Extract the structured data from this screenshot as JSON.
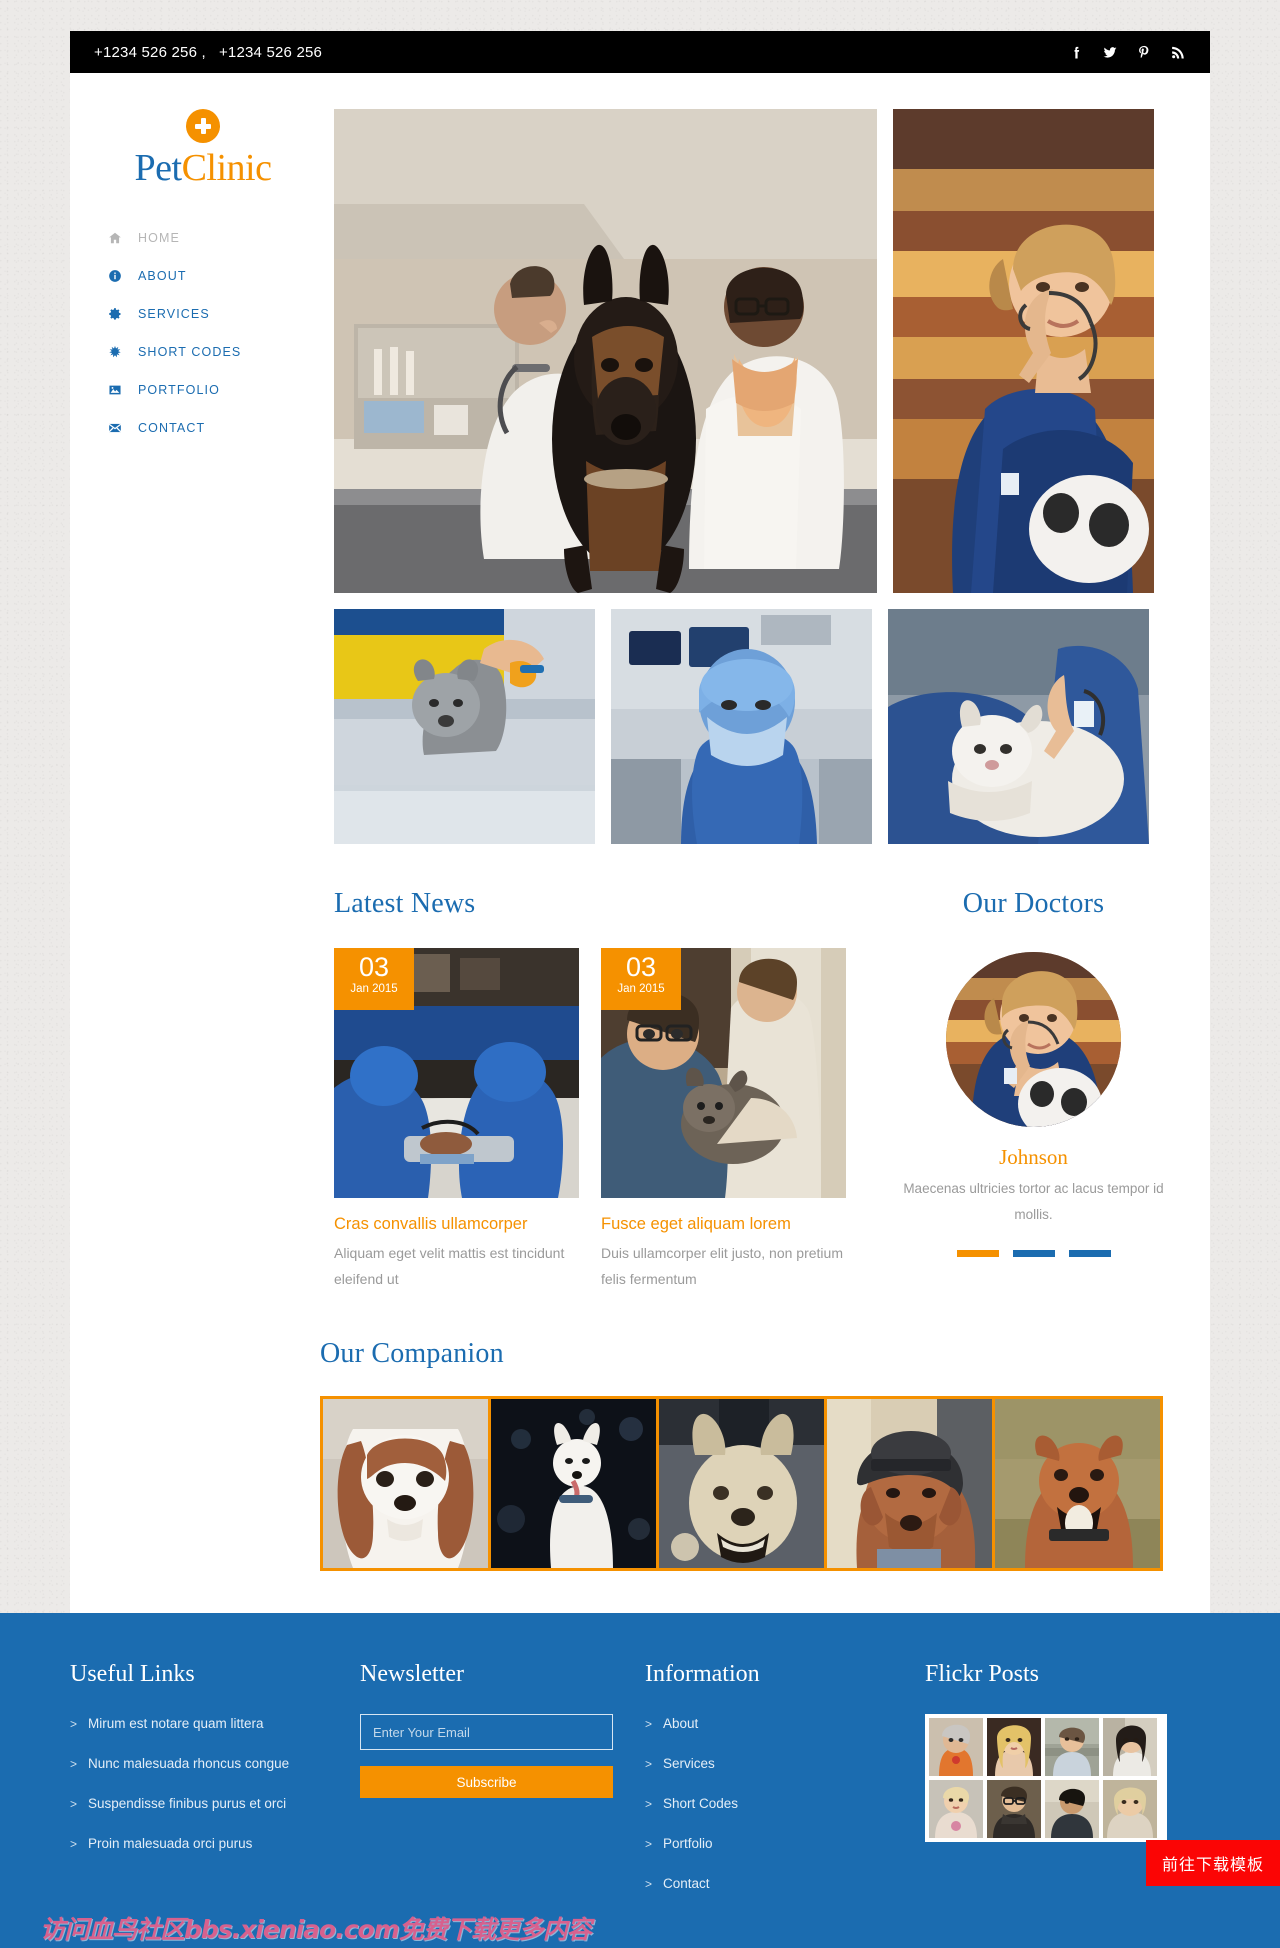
{
  "topbar": {
    "phones": "+1234 526 256 ,   +1234 526 256",
    "social": [
      {
        "name": "facebook-icon",
        "label": "Facebook"
      },
      {
        "name": "twitter-icon",
        "label": "Twitter"
      },
      {
        "name": "pinterest-icon",
        "label": "Pinterest"
      },
      {
        "name": "rss-icon",
        "label": "RSS"
      }
    ]
  },
  "brand": {
    "part1": "Pet",
    "part2": "Clinic",
    "mark": "plus-circle-icon"
  },
  "nav": {
    "items": [
      {
        "label": "HOME",
        "icon": "home-icon",
        "active": true
      },
      {
        "label": "ABOUT",
        "icon": "info-icon",
        "active": false
      },
      {
        "label": "SERVICES",
        "icon": "gear-icon",
        "active": false
      },
      {
        "label": "SHORT CODES",
        "icon": "asterisk-icon",
        "active": false
      },
      {
        "label": "PORTFOLIO",
        "icon": "image-icon",
        "active": false
      },
      {
        "label": "CONTACT",
        "icon": "envelope-icon",
        "active": false
      }
    ]
  },
  "hero": {
    "main_alt": "Two veterinarians examining a doberman on an exam table",
    "side_alt": "Veterinary nurse in blue scrubs with stethoscope holding a cat"
  },
  "thumbs": [
    {
      "alt": "Puppy being examined on a table"
    },
    {
      "alt": "Surgeon in blue scrubs and cap in operating room"
    },
    {
      "alt": "Vet examining a white cat with stethoscope"
    }
  ],
  "news": {
    "title": "Latest News",
    "posts": [
      {
        "day": "03",
        "month": "Jan 2015",
        "title": "Cras convallis ullamcorper",
        "desc": "Aliquam eget velit mattis est tincidunt eleifend ut",
        "alt": "Surgical team operating on an animal"
      },
      {
        "day": "03",
        "month": "Jan 2015",
        "title": "Fusce eget aliquam lorem",
        "desc": "Duis ullamcorper elit justo, non pretium felis fermentum",
        "alt": "Veterinarian holding a dog assisted by a colleague"
      }
    ]
  },
  "doctors": {
    "title": "Our Doctors",
    "name": "Johnson",
    "desc": "Maecenas ultricies tortor ac lacus tempor id mollis.",
    "dots": [
      {
        "active": true
      },
      {
        "active": false
      },
      {
        "active": false
      }
    ],
    "photo_alt": "Doctor Johnson, blonde woman in blue scrubs with stethoscope"
  },
  "companion": {
    "title": "Our Companion",
    "items": [
      {
        "alt": "Cavalier King Charles Spaniel"
      },
      {
        "alt": "White husky in the dark"
      },
      {
        "alt": "Cream coloured shepherd dog"
      },
      {
        "alt": "Dogue de Bordeaux wearing a grey fedora"
      },
      {
        "alt": "Brown terrier mix sitting in grass"
      }
    ]
  },
  "footer": {
    "links": {
      "title": "Useful Links",
      "arrow": ">",
      "items": [
        "Mirum est notare quam littera",
        "Nunc malesuada rhoncus congue",
        "Suspendisse finibus purus et orci",
        "Proin malesuada orci purus"
      ]
    },
    "newsletter": {
      "title": "Newsletter",
      "placeholder": "Enter Your Email",
      "value": "",
      "button": "Subscribe"
    },
    "information": {
      "title": "Information",
      "arrow": ">",
      "items": [
        "About",
        "Services",
        "Short Codes",
        "Portfolio",
        "Contact"
      ]
    },
    "flickr": {
      "title": "Flickr Posts",
      "items": [
        {
          "alt": "Older woman in orange patterned top"
        },
        {
          "alt": "Blonde woman dark background"
        },
        {
          "alt": "Young man in light shirt outdoors"
        },
        {
          "alt": "Woman with dark bob haircut"
        },
        {
          "alt": "Blonde woman in pale dress"
        },
        {
          "alt": "Man with glasses and scarf"
        },
        {
          "alt": "Dark haired young man outdoors"
        },
        {
          "alt": "Blonde woman close up"
        }
      ]
    }
  },
  "overlay": {
    "download_button": "前往下载模板",
    "watermark": "访问血鸟社区bbs.xieniao.com免费下载更多内容"
  },
  "colors": {
    "brand_blue": "#1b6cb0",
    "brand_orange": "#f59100",
    "topbar_black": "#000000",
    "page_bg": "#eceae8",
    "muted_text": "#9a9a9a",
    "download_red": "#fb0505"
  }
}
